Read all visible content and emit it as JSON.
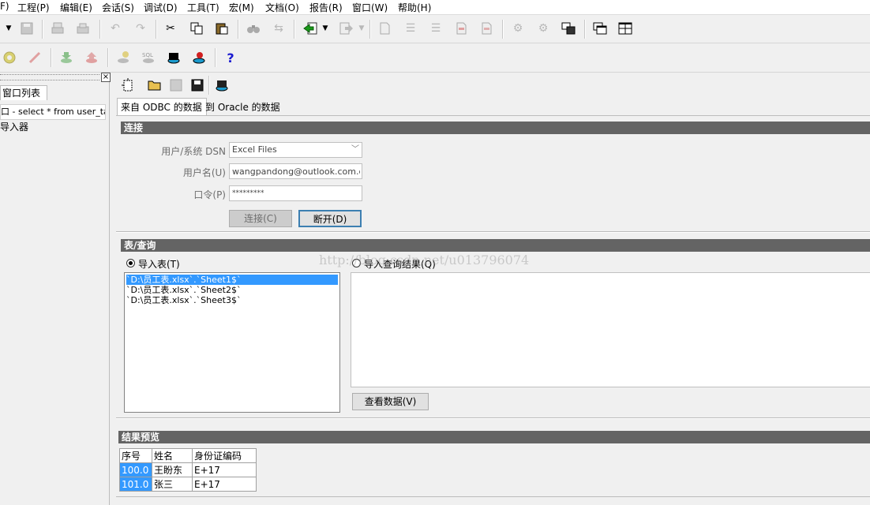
{
  "menu": [
    "F)",
    "工程(P)",
    "编辑(E)",
    "会话(S)",
    "调试(D)",
    "工具(T)",
    "宏(M)",
    "文档(O)",
    "报告(R)",
    "窗口(W)",
    "帮助(H)"
  ],
  "left_panel": {
    "close_label": "×",
    "tab_label": "窗口列表",
    "items": [
      "口 - select * from user_table",
      "导入器"
    ]
  },
  "tabs": [
    "来自 ODBC 的数据",
    "到 Oracle 的数据"
  ],
  "connection": {
    "title": "连接",
    "dsn_label": "用户/系统 DSN",
    "dsn_value": "Excel Files",
    "user_label": "用户名(U)",
    "user_value": "wangpandong@outlook.com.cn",
    "password_label": "口令(P)",
    "password_value": "*********",
    "connect_label": "连接(C)",
    "disconnect_label": "断开(D)"
  },
  "table_query": {
    "title": "表/查询",
    "import_table_label": "导入表(T)",
    "import_query_label": "导入查询结果(Q)",
    "tables": [
      "`D:\\员工表.xlsx`.`Sheet1$`",
      "`D:\\员工表.xlsx`.`Sheet2$`",
      "`D:\\员工表.xlsx`.`Sheet3$`"
    ],
    "selected_index": 0,
    "view_data_label": "查看数据(V)"
  },
  "watermark": "http://blog.csdn.net/u013796074",
  "preview": {
    "title": "结果预览",
    "columns": [
      "序号",
      "姓名",
      "身份证编码"
    ],
    "rows": [
      [
        "100.0",
        "王盼东",
        "E+17"
      ],
      [
        "101.0",
        "张三",
        "E+17"
      ]
    ]
  },
  "icons": {
    "help": "?"
  }
}
